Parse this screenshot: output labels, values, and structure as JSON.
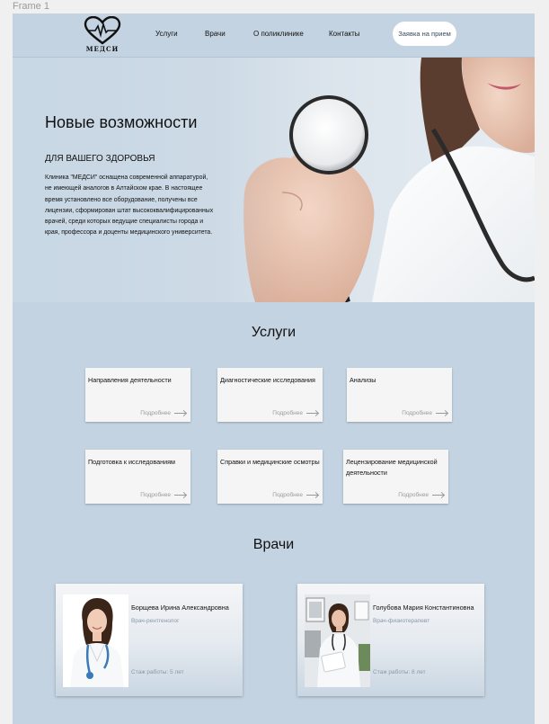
{
  "canvas_label": "Frame 1",
  "header": {
    "logo_text": "МЕДСИ",
    "nav": [
      "Услуги",
      "Врачи",
      "О поликлинике",
      "Контакты"
    ],
    "cta": "Заявка на прием"
  },
  "hero": {
    "title": "Новые возможности",
    "subtitle": "ДЛЯ ВАШЕГО ЗДОРОВЬЯ",
    "text": "Клиника \"МЕДСИ\" оснащена современной аппаратурой, не имеющей аналогов в Алтайском крае. В настоящее время установлено все оборудование, получены все лицензии, сформирован штат высококвалифицированных врачей, среди которых ведущие специалисты города и края, профессора и доценты медицинского университета."
  },
  "services": {
    "title": "Услуги",
    "more_label": "Подробнее",
    "items": [
      "Направления деятельности",
      "Диагностические исследования",
      "Анализы",
      "Подготовка к исследованиям",
      "Справки и медицинские осмотры",
      "Лецензирование медицинской деятельности"
    ]
  },
  "doctors": {
    "title": "Врачи",
    "items": [
      {
        "name": "Борщева Ирина Александровна",
        "role": "Врач-рентгенолог",
        "experience": "Стаж работы: 5 лет"
      },
      {
        "name": "Голубова Мария Константиновна",
        "role": "Врач-физиотерапевт",
        "experience": "Стаж работы: 8 лет"
      }
    ]
  },
  "colors": {
    "page_bg": "#c3d3e1",
    "card_bg": "#f5f5f5",
    "muted_text": "#999999",
    "cta_bg": "#ffffff"
  }
}
